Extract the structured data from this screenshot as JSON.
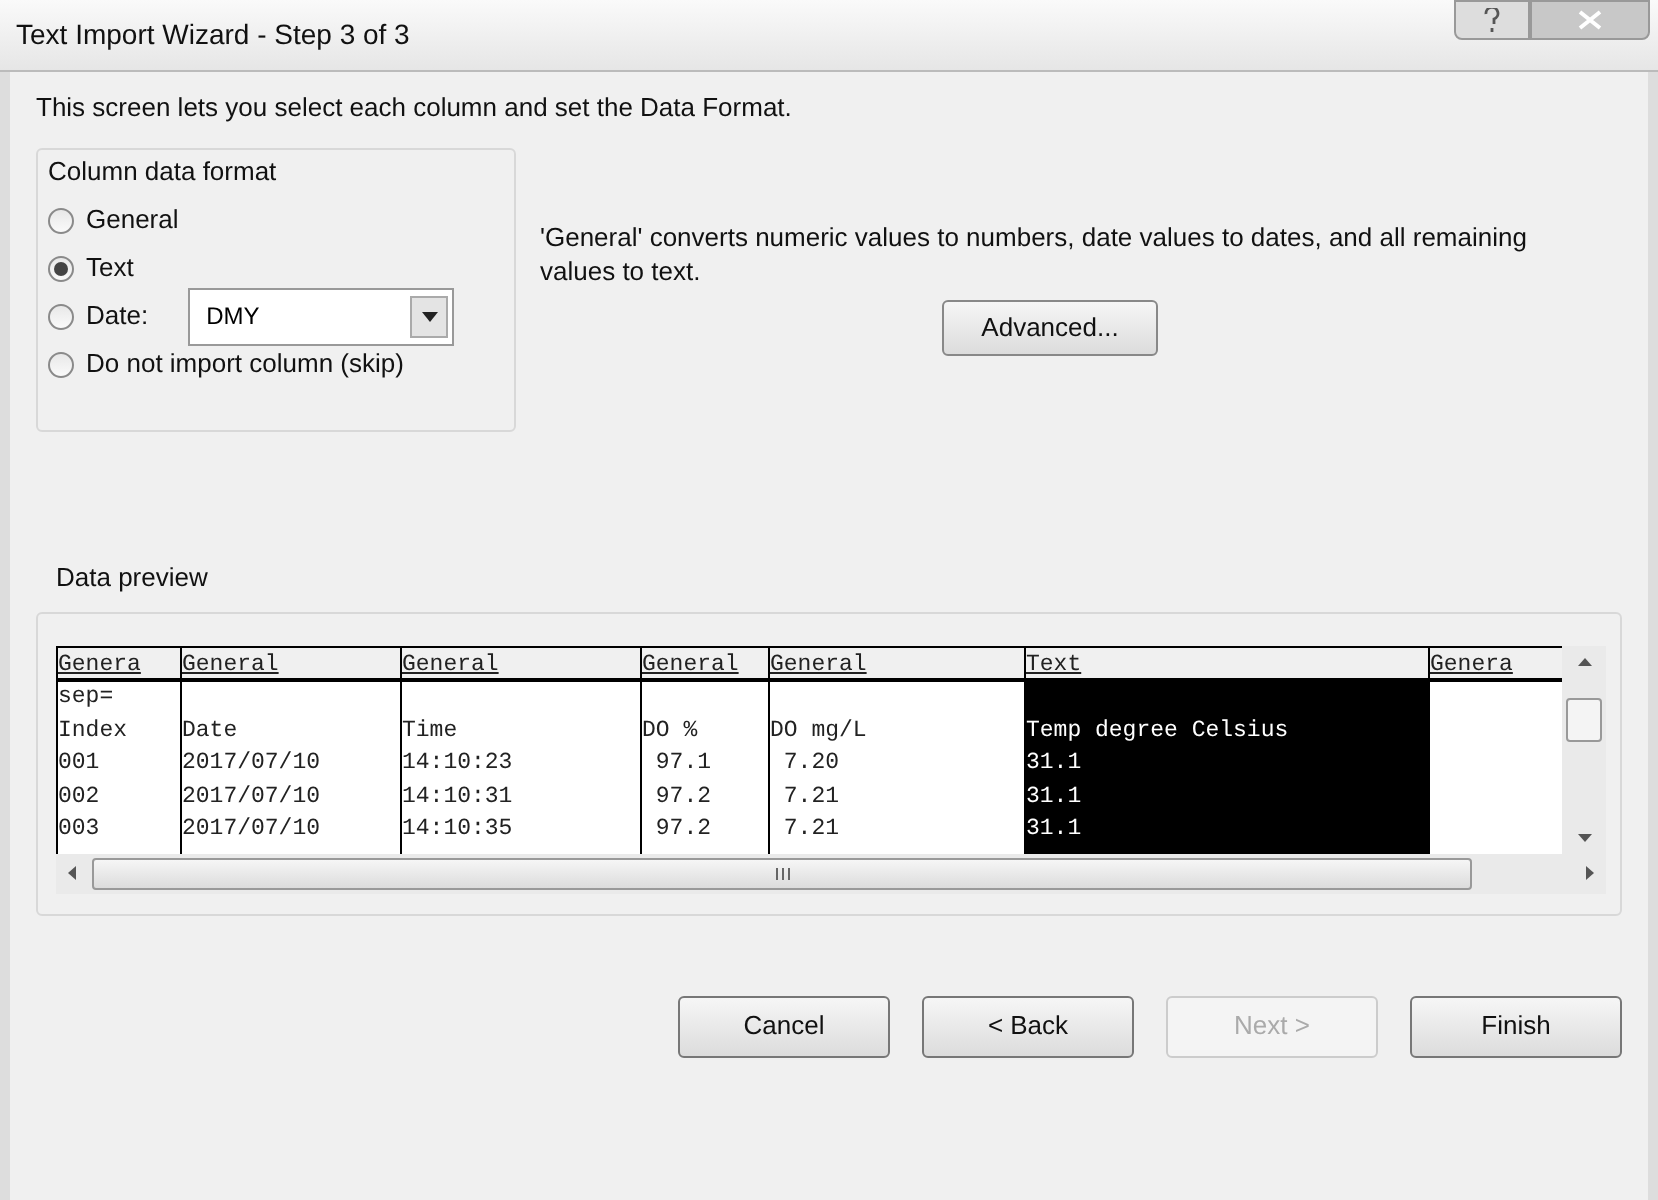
{
  "window": {
    "title": "Text Import Wizard - Step 3 of 3"
  },
  "intro": "This screen lets you select each column and set the Data Format.",
  "column_data_format": {
    "title": "Column data format",
    "options": [
      {
        "label": "General",
        "selected": false
      },
      {
        "label": "Text",
        "selected": true
      },
      {
        "label": "Date:",
        "selected": false,
        "dropdown": "DMY"
      },
      {
        "label": "Do not import column (skip)",
        "selected": false
      }
    ]
  },
  "description": "'General' converts numeric values to numbers, date values to dates, and all remaining values to text.",
  "advanced_button": "Advanced...",
  "data_preview": {
    "title": "Data preview",
    "columns": [
      {
        "format": "Genera",
        "selected": false
      },
      {
        "format": "General",
        "selected": false
      },
      {
        "format": "General",
        "selected": false
      },
      {
        "format": "General",
        "selected": false
      },
      {
        "format": "General",
        "selected": false
      },
      {
        "format": "Text",
        "selected": true
      },
      {
        "format": "Genera",
        "selected": false
      }
    ],
    "rows": [
      [
        "sep=",
        "",
        "",
        "",
        "",
        "",
        ""
      ],
      [
        "Index",
        "Date",
        "Time",
        "DO %",
        "DO mg/L",
        "Temp degree Celsius",
        ""
      ],
      [
        "001",
        "2017/07/10",
        "14:10:23",
        " 97.1",
        " 7.20",
        "31.1",
        ""
      ],
      [
        "002",
        "2017/07/10",
        "14:10:31",
        " 97.2",
        " 7.21",
        "31.1",
        ""
      ],
      [
        "003",
        "2017/07/10",
        "14:10:35",
        " 97.2",
        " 7.21",
        "31.1",
        ""
      ]
    ]
  },
  "buttons": [
    {
      "label": "Cancel",
      "disabled": false
    },
    {
      "label": "< Back",
      "disabled": false
    },
    {
      "label": "Next >",
      "disabled": true
    },
    {
      "label": "Finish",
      "disabled": false
    }
  ]
}
